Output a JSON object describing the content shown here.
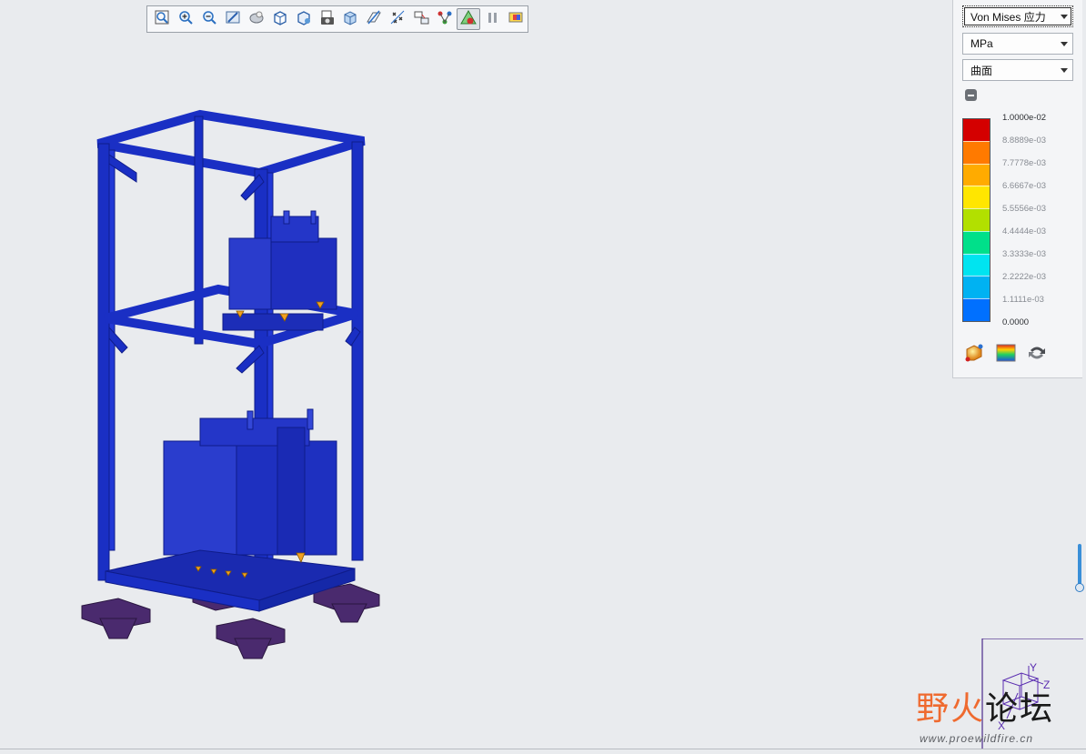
{
  "toolbar": {
    "buttons": [
      {
        "name": "zoom-fit-icon"
      },
      {
        "name": "zoom-in-icon"
      },
      {
        "name": "zoom-out-icon"
      },
      {
        "name": "repaint-icon"
      },
      {
        "name": "spin-center-icon"
      },
      {
        "name": "saved-views-icon"
      },
      {
        "name": "view-manager-icon"
      },
      {
        "name": "camera-icon"
      },
      {
        "name": "display-style-icon"
      },
      {
        "name": "datum-plane-icon"
      },
      {
        "name": "datum-points-icon"
      },
      {
        "name": "annotation-display-icon"
      },
      {
        "name": "connection-icon"
      },
      {
        "name": "result-display-icon",
        "active": true
      },
      {
        "name": "pause-icon"
      },
      {
        "name": "animation-icon"
      }
    ]
  },
  "panel": {
    "quantity": "Von Mises 应力",
    "unit": "MPa",
    "display_type": "曲面",
    "legend": {
      "labels": [
        "1.0000e-02",
        "8.8889e-03",
        "7.7778e-03",
        "6.6667e-03",
        "5.5556e-03",
        "4.4444e-03",
        "3.3333e-03",
        "2.2222e-03",
        "1.1111e-03",
        "0.0000"
      ],
      "colors": [
        "#d40000",
        "#ff7a00",
        "#ffab00",
        "#ffe600",
        "#b2e000",
        "#00e08a",
        "#00e4f0",
        "#00b2f2",
        "#0070ff"
      ]
    },
    "icons": [
      "legend-settings-icon",
      "color-spectrum-icon",
      "swap-icon"
    ]
  },
  "triad": {
    "x": "X",
    "y": "Y",
    "z": "Z"
  },
  "watermark": {
    "fire": "野火",
    "forum": "论坛",
    "url": "www.proewildfire.cn"
  }
}
